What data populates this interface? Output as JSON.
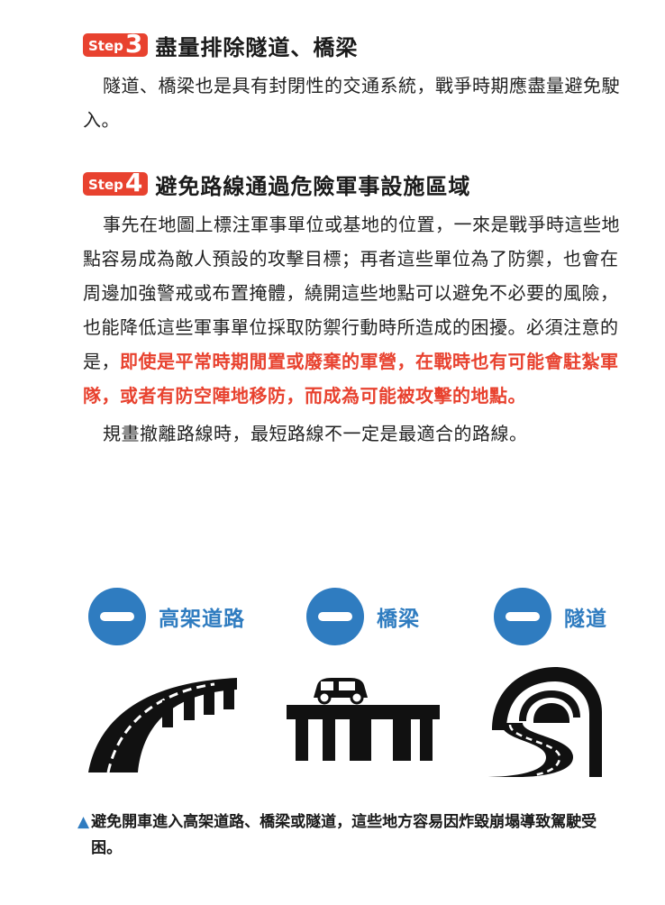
{
  "step3": {
    "badge_word": "Step",
    "badge_num": "3",
    "title": "盡量排除隧道、橋梁",
    "paragraph": "隧道、橋梁也是具有封閉性的交通系統，戰爭時期應盡量避免駛入。"
  },
  "step4": {
    "badge_word": "Step",
    "badge_num": "4",
    "title": "避免路線通過危險軍事設施區域",
    "paragraph_before": "事先在地圖上標注軍事單位或基地的位置，一來是戰爭時這些地點容易成為敵人預設的攻擊目標；再者這些單位為了防禦，也會在周邊加強警戒或布置掩體，繞開這些地點可以避免不必要的風險，也能降低這些軍事單位採取防禦行動時所造成的困擾。必須注意的是，",
    "paragraph_highlight": "即使是平常時期閒置或廢棄的軍營，在戰時也有可能會駐紮軍隊，或者有防空陣地移防，而成為可能被攻擊的地點。",
    "paragraph2": "規畫撤離路線時，最短路線不一定是最適合的路線。"
  },
  "icons": {
    "items": [
      {
        "label": "高架道路",
        "icon": "elevated-road-icon"
      },
      {
        "label": "橋梁",
        "icon": "bridge-icon"
      },
      {
        "label": "隧道",
        "icon": "tunnel-icon"
      }
    ],
    "minus_icon": "minus-circle-icon",
    "accent_color": "#2f7cc0"
  },
  "caption": {
    "marker": "▲",
    "text": "避免開車進入高架道路、橋梁或隧道，這些地方容易因炸毀崩塌導致駕駛受困。"
  },
  "colors": {
    "highlight": "#e8422f",
    "badge": "#e8422f",
    "blue": "#2f7cc0"
  }
}
